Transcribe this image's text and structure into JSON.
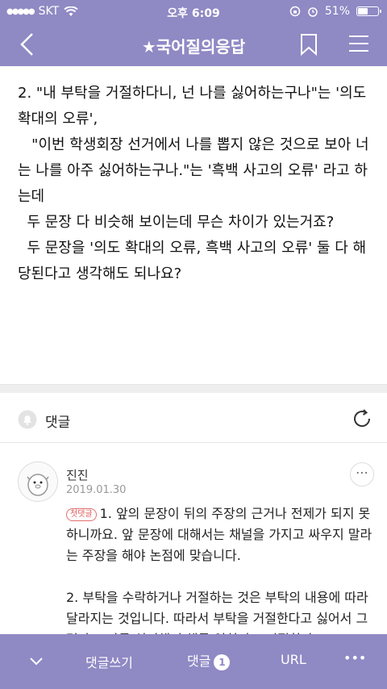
{
  "status": {
    "carrier": "SKT",
    "time": "오후 6:09",
    "battery": "51%",
    "battery_level": 0.51
  },
  "header": {
    "title": "★국어질의응답"
  },
  "post": {
    "body": "2. \"내 부탁을 거절하다니, 넌 나를 싫어하는구나\"는 '의도 확대의 오류',\n   \"이번 학생회장 선거에서 나를 뽑지 않은 것으로 보아 너는 나를 아주 싫어하는구나.\"는 '흑백 사고의 오류' 라고 하는데\n  두 문장 다 비슷해 보이는데 무슨 차이가 있는거죠?\n  두 문장을 '의도 확대의 오류, 흑백 사고의 오류' 둘 다 해당된다고 생각해도 되나요?"
  },
  "comments_section": {
    "label": "댓글"
  },
  "comment": {
    "author": "진진",
    "date": "2019.01.30",
    "badge": "첫댓글",
    "para1": "1. 앞의 문장이 뒤의 주장의 근거나 전제가 되지 못하니까요. 앞 문장에 대해서는 채널을 가지고 싸우지 말라는 주장을 해야 논점에 맞습니다.",
    "para2": "2. 부탁을 수락하거나 거절하는 것은 부탁의 내용에 따라 달라지는 것입니다. 따라서 부탁을 거절한다고 싫어서 그런다고(나를 싫어해서 해를 입히려고 거절한다고"
  },
  "bottom": {
    "write": "댓글쓰기",
    "comments": "댓글",
    "comment_count": "1",
    "url": "URL",
    "more": "•••"
  }
}
